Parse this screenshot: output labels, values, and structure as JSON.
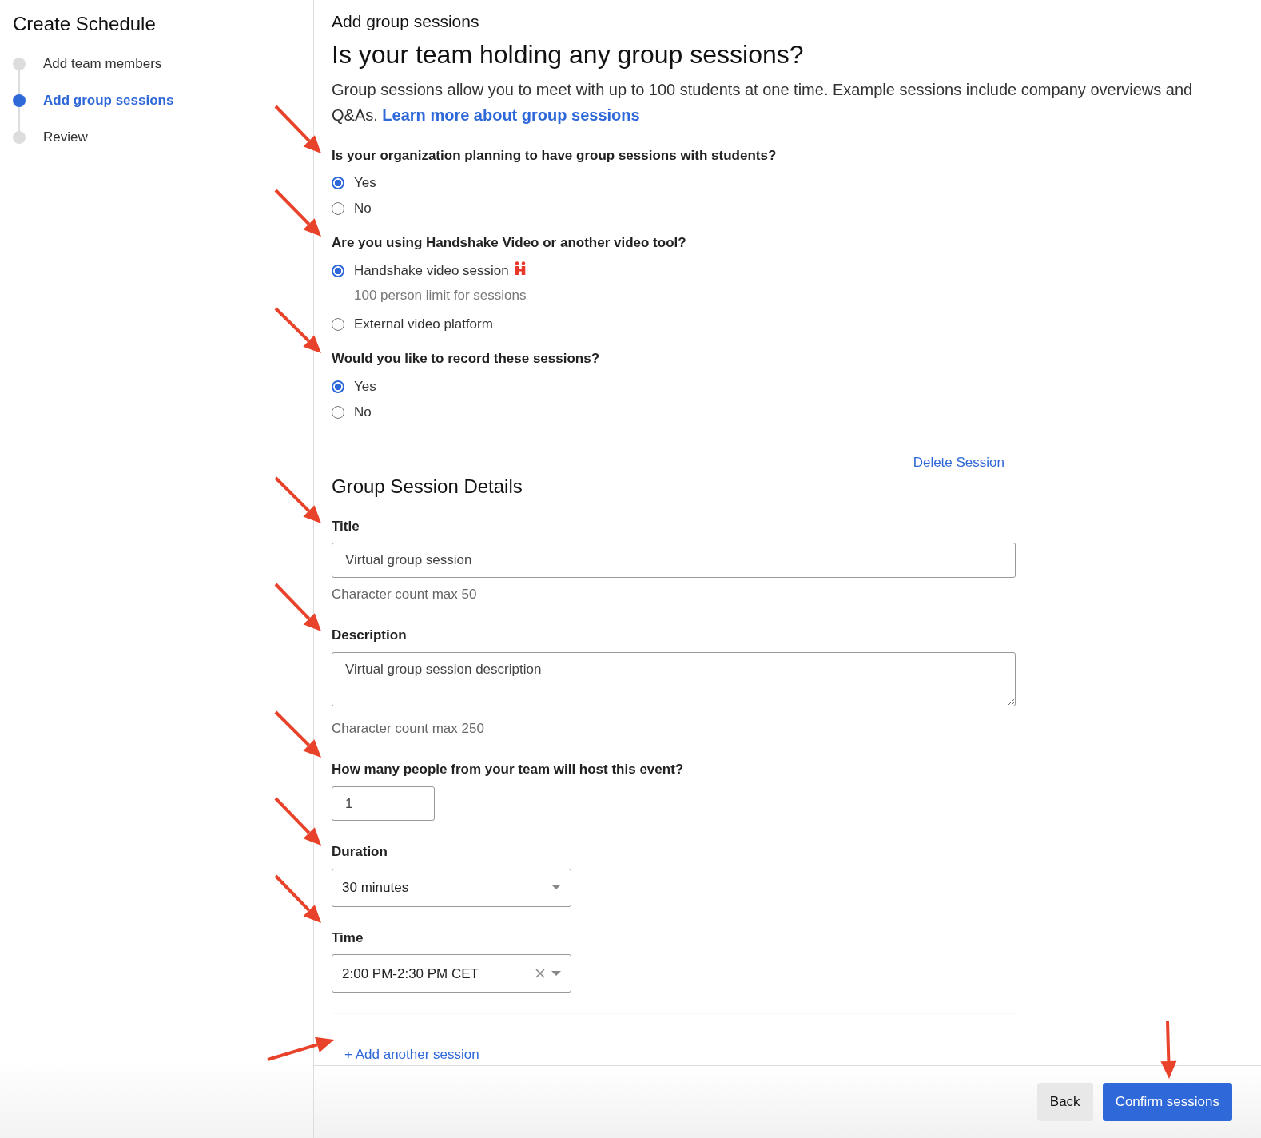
{
  "sidebar": {
    "title": "Create Schedule",
    "steps": [
      {
        "label": "Add team members",
        "selected": false
      },
      {
        "label": "Add group sessions",
        "selected": true
      },
      {
        "label": "Review",
        "selected": false
      }
    ]
  },
  "page": {
    "eyebrow": "Add group sessions",
    "heading": "Is your team holding any group sessions?",
    "intro": "Group sessions allow you to meet with up to 100 students at one time. Example sessions include company overviews and Q&As.",
    "intro_link": "Learn more about group sessions"
  },
  "questions": [
    {
      "label": "Is your organization planning to have group sessions with students?",
      "options": [
        {
          "label": "Yes",
          "selected": true
        },
        {
          "label": "No",
          "selected": false
        }
      ]
    },
    {
      "label": "Are you using Handshake Video or another video tool?",
      "options": [
        {
          "label": "Handshake video session",
          "selected": true,
          "logo": true,
          "note": "100 person limit for sessions"
        },
        {
          "label": "External video platform",
          "selected": false
        }
      ]
    },
    {
      "label": "Would you like to record these sessions?",
      "options": [
        {
          "label": "Yes",
          "selected": true
        },
        {
          "label": "No",
          "selected": false
        }
      ]
    }
  ],
  "session": {
    "delete_link": "Delete Session",
    "heading": "Group Session Details",
    "fields": [
      {
        "kind": "text",
        "label": "Title",
        "value": "Virtual group session",
        "help": "Character count max 50"
      },
      {
        "kind": "textarea",
        "label": "Description",
        "value": "Virtual group session description",
        "help": "Character count max 250"
      },
      {
        "kind": "number",
        "label": "How many people from your team will host this event?",
        "value": "1"
      },
      {
        "kind": "select",
        "label": "Duration",
        "value": "30 minutes",
        "clearable": false
      },
      {
        "kind": "select",
        "label": "Time",
        "value": "2:00 PM-2:30 PM CET",
        "clearable": true
      }
    ]
  },
  "add_link": "+ Add another session",
  "footer": {
    "buttons": [
      {
        "label": "Back",
        "kind": "secondary"
      },
      {
        "label": "Confirm sessions",
        "kind": "primary"
      }
    ]
  }
}
